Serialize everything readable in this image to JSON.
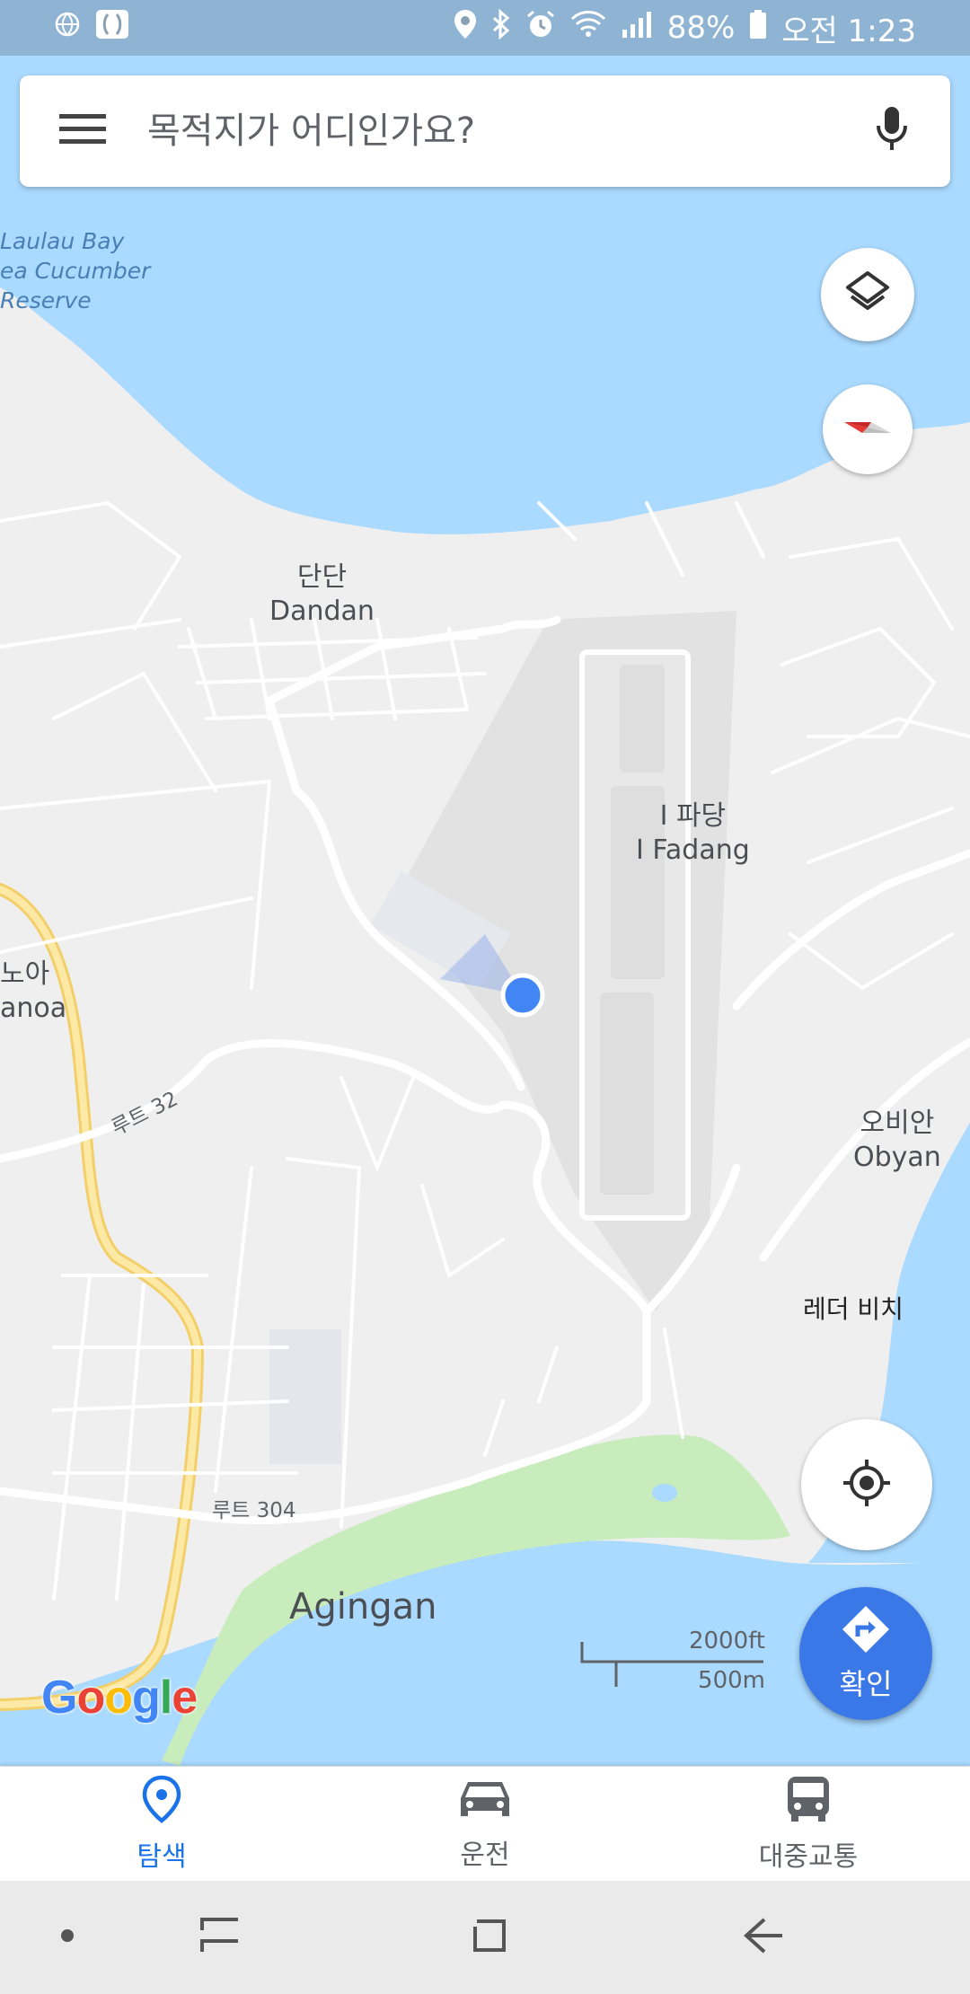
{
  "status_bar": {
    "battery": "88%",
    "time": "오전 1:23"
  },
  "search": {
    "placeholder": "목적지가 어디인가요?"
  },
  "map": {
    "labels": {
      "laulau": "Laulau Bay\nea Cucumber\nReserve",
      "dandan_ko": "단단",
      "dandan_en": "Dandan",
      "ifadang_ko": "I 파당",
      "ifadang_en": "I Fadang",
      "anoa_ko": "노아",
      "anoa_en": "anoa",
      "obyan_ko": "오비안",
      "obyan_en": "Obyan",
      "ladder": "레더 비치",
      "agingan": "Agingan",
      "route32": "루트 32",
      "route304": "루트 304"
    },
    "scale": {
      "imperial": "2000ft",
      "metric": "500m"
    },
    "colors": {
      "water": "#aadaff",
      "land": "#efefef",
      "road": "#ffffff",
      "highway": "#fbe48c",
      "park": "#c8ecbc",
      "airport": "#e2e2e2",
      "my_location": "#4285f4"
    }
  },
  "fab": {
    "directions_label": "확인"
  },
  "bottom_nav": {
    "tabs": [
      {
        "label": "탐색",
        "icon": "location-pin-icon",
        "active": true
      },
      {
        "label": "운전",
        "icon": "car-icon",
        "active": false
      },
      {
        "label": "대중교통",
        "icon": "bus-icon",
        "active": false
      }
    ]
  },
  "branding": {
    "logo_letters": [
      "G",
      "o",
      "o",
      "g",
      "l",
      "e"
    ],
    "logo_colors": [
      "#4285f4",
      "#ea4335",
      "#fbbc05",
      "#4285f4",
      "#34a853",
      "#ea4335"
    ]
  }
}
